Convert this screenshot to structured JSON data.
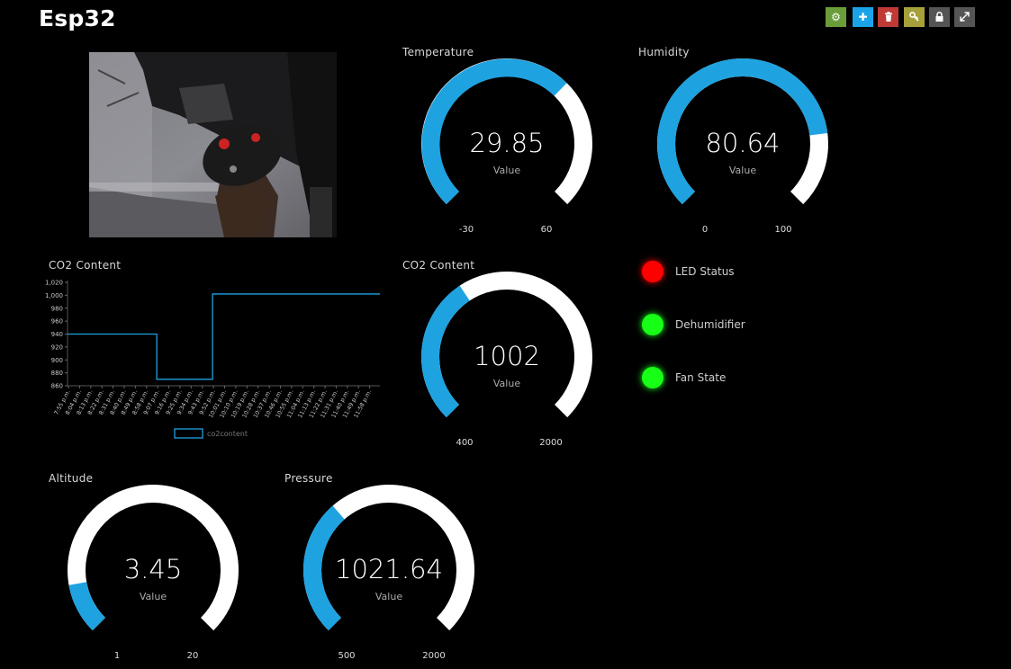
{
  "header": {
    "title": "Esp32"
  },
  "toolbar": {
    "buttons": [
      {
        "icon": "gear-icon",
        "glyph": "⚙",
        "color": "#6a9d3a"
      },
      {
        "icon": "plus-icon",
        "glyph": "✚",
        "color": "#1aa3e8"
      },
      {
        "icon": "trash-icon",
        "glyph": "🗑",
        "color": "#c03a35"
      },
      {
        "icon": "key-icon",
        "glyph": "⚷",
        "color": "#a6a03a"
      },
      {
        "icon": "lock-icon",
        "glyph": "🔒",
        "color": "#555555"
      },
      {
        "icon": "expand-icon",
        "glyph": "⤢",
        "color": "#555555"
      }
    ]
  },
  "colors": {
    "accent": "#1fa2e0",
    "track": "#ffffff",
    "led_red": "#ff0000",
    "led_green": "#17ff17"
  },
  "gauges": {
    "temperature": {
      "title": "Temperature",
      "value": "29.85",
      "num": 29.85,
      "min": -30,
      "max": 60,
      "min_label": "-30",
      "max_label": "60",
      "sub": "Value"
    },
    "humidity": {
      "title": "Humidity",
      "value": "80.64",
      "num": 80.64,
      "min": 0,
      "max": 100,
      "min_label": "0",
      "max_label": "100",
      "sub": "Value"
    },
    "co2": {
      "title": "CO2 Content",
      "value": "1002",
      "num": 1002,
      "min": 400,
      "max": 2000,
      "min_label": "400",
      "max_label": "2000",
      "sub": "Value"
    },
    "altitude": {
      "title": "Altitude",
      "value": "3.45",
      "num": 3.45,
      "min": 1,
      "max": 20,
      "min_label": "1",
      "max_label": "20",
      "sub": "Value"
    },
    "pressure": {
      "title": "Pressure",
      "value": "1021.64",
      "num": 1021.64,
      "min": 500,
      "max": 2000,
      "min_label": "500",
      "max_label": "2000",
      "sub": "Value"
    }
  },
  "indicators": [
    {
      "label": "LED Status",
      "color": "#ff0000"
    },
    {
      "label": "Dehumidifier",
      "color": "#17ff17"
    },
    {
      "label": "Fan State",
      "color": "#17ff17"
    }
  ],
  "chart_panel": {
    "title": "CO2 Content"
  },
  "chart_data": {
    "type": "line",
    "title": "CO2 Content",
    "xlabel": "",
    "ylabel": "",
    "ylim": [
      860,
      1020
    ],
    "yticks": [
      "1,020",
      "1,000",
      "980",
      "960",
      "940",
      "920",
      "900",
      "880",
      "860"
    ],
    "ytick_values": [
      1020,
      1000,
      980,
      960,
      940,
      920,
      900,
      880,
      860
    ],
    "categories": [
      "7:55 p.m.",
      "8:04 p.m.",
      "8:13 p.m.",
      "8:22 p.m.",
      "8:31 p.m.",
      "8:40 p.m.",
      "8:49 p.m.",
      "8:58 p.m.",
      "9:07 p.m.",
      "9:16 p.m.",
      "9:25 p.m.",
      "9:34 p.m.",
      "9:43 p.m.",
      "9:52 p.m.",
      "10:01 p.m.",
      "10:10 p.m.",
      "10:19 p.m.",
      "10:28 p.m.",
      "10:37 p.m.",
      "10:46 p.m.",
      "10:55 p.m.",
      "11:04 p.m.",
      "11:13 p.m.",
      "11:22 p.m.",
      "11:31 p.m.",
      "11:40 p.m.",
      "11:49 p.m.",
      "11:58 p.m."
    ],
    "series": [
      {
        "name": "co2content",
        "step": "after",
        "values": [
          940,
          940,
          940,
          940,
          940,
          940,
          940,
          940,
          870,
          870,
          870,
          870,
          870,
          1002,
          1002,
          1002,
          1002,
          1002,
          1002,
          1002,
          1002,
          1002,
          1002,
          1002,
          1002,
          1002,
          1002,
          1002
        ]
      }
    ],
    "legend": "bottom-center",
    "grid": false
  }
}
